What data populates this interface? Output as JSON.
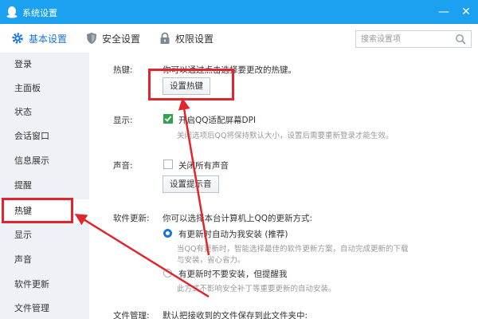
{
  "window": {
    "title": "系统设置",
    "minimize": "—",
    "close": "✕"
  },
  "tabs": [
    {
      "label": "基本设置",
      "icon": "gear-icon",
      "active": true
    },
    {
      "label": "安全设置",
      "icon": "shield-icon",
      "active": false
    },
    {
      "label": "权限设置",
      "icon": "lock-icon",
      "active": false
    }
  ],
  "search": {
    "placeholder": "搜索设置项",
    "value": ""
  },
  "sidebar": {
    "items": [
      {
        "label": "登录"
      },
      {
        "label": "主面板"
      },
      {
        "label": "状态"
      },
      {
        "label": "会话窗口"
      },
      {
        "label": "信息展示"
      },
      {
        "label": "提醒"
      },
      {
        "label": "热键",
        "active": true
      },
      {
        "label": "显示"
      },
      {
        "label": "声音"
      },
      {
        "label": "软件更新"
      },
      {
        "label": "文件管理"
      }
    ]
  },
  "sections": {
    "hotkey": {
      "label": "热键:",
      "desc": "你可以通过点击选择要更改的热键。",
      "button": "设置热键"
    },
    "display": {
      "label": "显示:",
      "checkbox_label": "开启QQ适配屏幕DPI",
      "checked": true,
      "hint": "关闭选项后QQ将保持默认大小，设置后需要重新登录才能生效。"
    },
    "sound": {
      "label": "声音:",
      "checkbox_label": "关闭所有声音",
      "checked": false,
      "button": "设置提示音"
    },
    "update": {
      "label": "软件更新:",
      "desc": "你可以选择本台计算机上QQ的更新方式:",
      "option1": "有更新时自动为我安装 (推荐)",
      "option1_hint1": "当QQ有更新时，智能选择最佳的软件更新方案，自动完成更新的下载",
      "option1_hint2": "与安装，省心省力。",
      "option2": "有更新时不要安装，但提醒我",
      "option2_hint": "此方式不影响安全补丁等重要更新的自动安装。",
      "selected": 1
    },
    "files": {
      "label": "文件管理:",
      "desc": "默认把接收到的文件保存到此文件夹中:"
    }
  },
  "colors": {
    "titlebar": "#1ba1f0",
    "accent": "#1b74d6",
    "annotation": "#e0262d",
    "sidebar_bg": "#eef2f6"
  }
}
